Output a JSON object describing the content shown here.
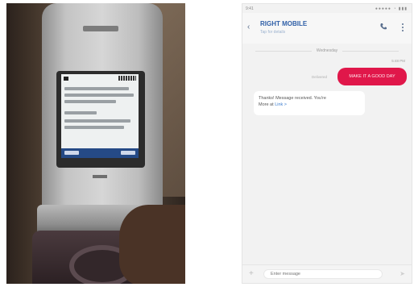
{
  "photo": {
    "description_icons": [
      "phone-screen-icon"
    ]
  },
  "messaging": {
    "status_bar": {
      "time": "9:41",
      "icons": "●●●●● ◔ ▮▮▮"
    },
    "app_bar": {
      "back_symbol": "‹",
      "contact_name": "RIGHT MOBILE",
      "contact_sub": "Tap for details"
    },
    "date_separator": "Wednesday",
    "sent": {
      "time": "5:48 PM",
      "status": "Delivered",
      "text": "MAKE IT A GOOD DAY"
    },
    "received": {
      "line1": "Thanks! Message received. You're",
      "line2_prefix": "More at ",
      "link": "Link >"
    },
    "composer": {
      "plus": "+",
      "placeholder": "Enter message",
      "send_symbol": "➤"
    },
    "colors": {
      "accent": "#e0174a",
      "link": "#3f7fd0",
      "title": "#2f5fa7"
    }
  }
}
